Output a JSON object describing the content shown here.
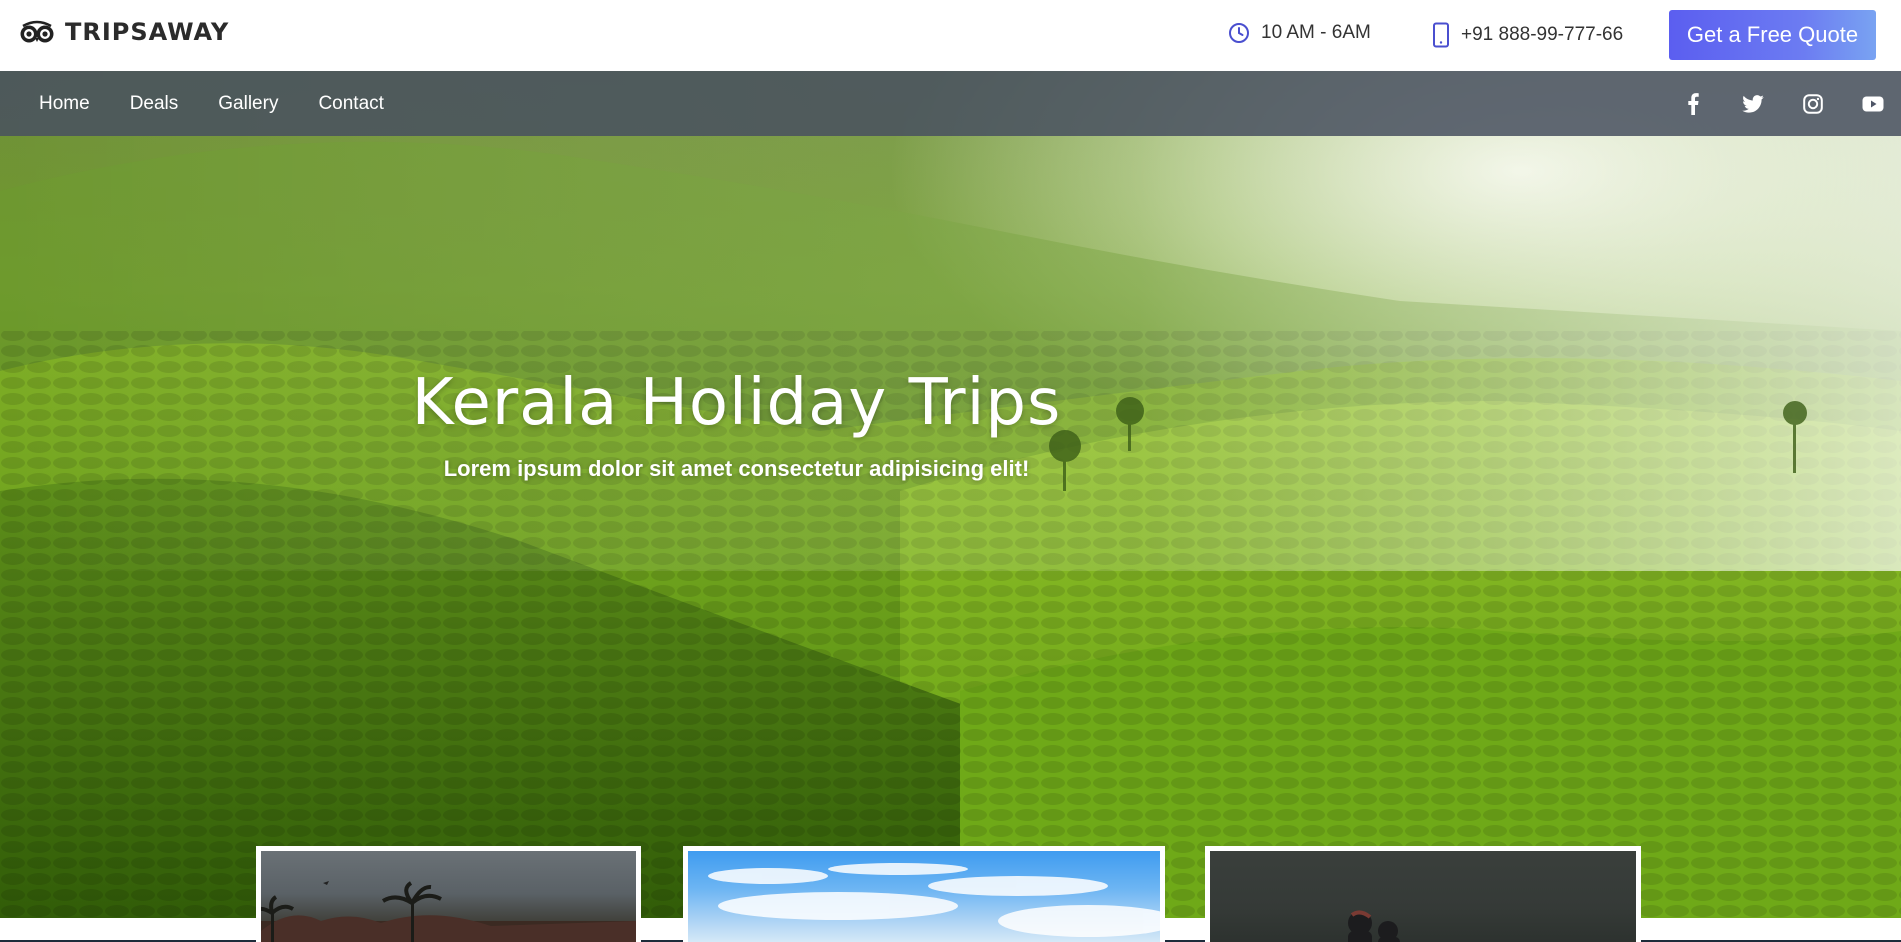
{
  "brand": {
    "name": "TRIPSAWAY",
    "logo_icon": "binoculars-owl-icon"
  },
  "contact": {
    "hours": "10 AM - 6AM",
    "hours_icon": "clock-icon",
    "phone": "+91 888-99-777-66",
    "phone_icon": "smartphone-icon"
  },
  "cta": {
    "label": "Get a Free Quote",
    "color": "#5b5ef0"
  },
  "nav": {
    "items": [
      {
        "label": "Home"
      },
      {
        "label": "Deals"
      },
      {
        "label": "Gallery"
      },
      {
        "label": "Contact"
      }
    ],
    "socials": [
      "facebook-icon",
      "twitter-icon",
      "instagram-icon",
      "youtube-icon"
    ]
  },
  "hero": {
    "title": "Kerala Holiday Trips",
    "subtitle": "Lorem ipsum dolor sit amet consectetur adipisicing elit!",
    "image": "green tea plantation hills"
  },
  "cards": [
    {
      "image": "palm-trees-dusk"
    },
    {
      "image": "blue-sky-clouds"
    },
    {
      "image": "dark-forest-people"
    }
  ]
}
